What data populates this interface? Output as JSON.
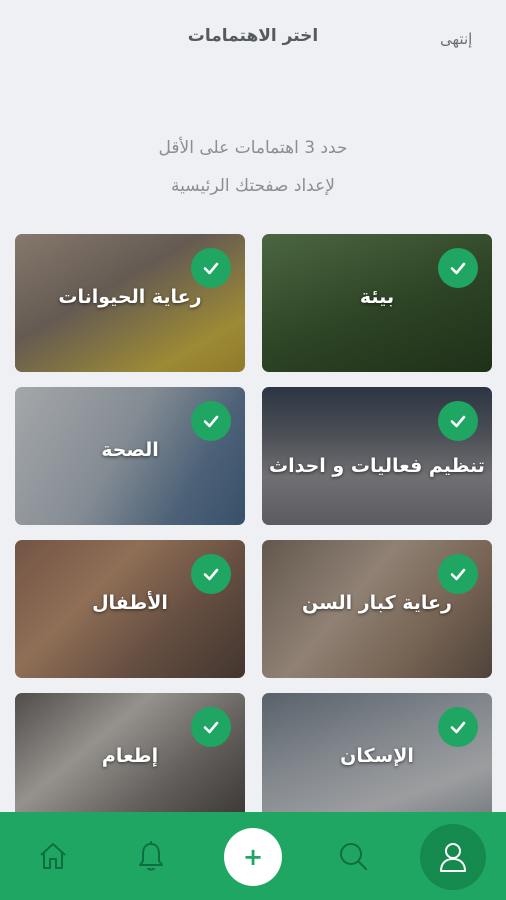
{
  "header": {
    "title": "اختر الاهتمامات",
    "done_label": "إنتهى"
  },
  "instructions": {
    "line1": "حدد 3 اهتمامات على الأقل",
    "line2": "لإعداد صفحتك الرئيسية"
  },
  "cards": [
    {
      "label": "بيئة",
      "selected": true,
      "icon": "check-icon"
    },
    {
      "label": "رعاية الحيوانات",
      "selected": true,
      "icon": "check-icon"
    },
    {
      "label": "تنظيم فعاليات و احداث",
      "selected": true,
      "icon": "check-icon"
    },
    {
      "label": "الصحة",
      "selected": true,
      "icon": "check-icon"
    },
    {
      "label": "رعاية كبار السن",
      "selected": true,
      "icon": "check-icon"
    },
    {
      "label": "الأطفال",
      "selected": true,
      "icon": "check-icon"
    },
    {
      "label": "الإسكان",
      "selected": true,
      "icon": "check-icon"
    },
    {
      "label": "إطعام",
      "selected": true,
      "icon": "check-icon"
    }
  ],
  "bottom_nav": {
    "items": [
      "home-icon",
      "bell-icon",
      "plus-icon",
      "search-icon",
      "profile-icon"
    ],
    "add_symbol": "+"
  },
  "colors": {
    "accent": "#1fa663",
    "background": "#eef0f3"
  }
}
